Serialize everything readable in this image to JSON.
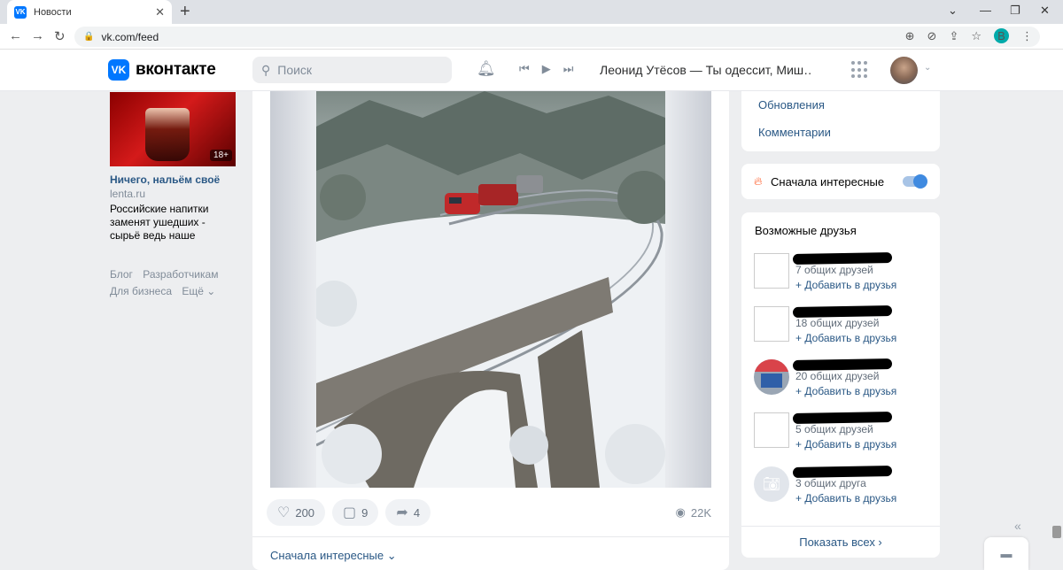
{
  "browser": {
    "tab_title": "Новости",
    "tab_favicon": "VK",
    "url": "vk.com/feed",
    "profile_letter": "B"
  },
  "header": {
    "logo_text": "вконтакте",
    "search_placeholder": "Поиск",
    "now_playing": "Леонид Утёсов — Ты одессит, Миш…"
  },
  "ad": {
    "badge": "18+",
    "title": "Ничего, нальём своё",
    "source": "lenta.ru",
    "description": "Российские напитки заменят ушедших - сырьё ведь наше"
  },
  "footer_links": [
    "Блог",
    "Разработчикам",
    "Для бизнеса",
    "Ещё ⌄"
  ],
  "post": {
    "likes": "200",
    "comments": "9",
    "shares": "4",
    "views": "22K",
    "sort_label": "Сначала интересные ⌄"
  },
  "right_menu": {
    "updates": "Обновления",
    "comments": "Комментарии"
  },
  "interesting_toggle": {
    "label": "Сначала интересные",
    "on": true
  },
  "friends": {
    "title": "Возможные друзья",
    "add_label": "+ Добавить в друзья",
    "items": [
      {
        "mutual": "7 общих друзей"
      },
      {
        "mutual": "18 общих друзей"
      },
      {
        "mutual": "20 общих друзей"
      },
      {
        "mutual": "5 общих друзей"
      },
      {
        "mutual": "3 общих друга"
      }
    ],
    "show_all": "Показать всех ›"
  },
  "colors": {
    "vk_blue": "#0077ff",
    "link": "#2a5885",
    "toggle": "#3f8ae0"
  }
}
